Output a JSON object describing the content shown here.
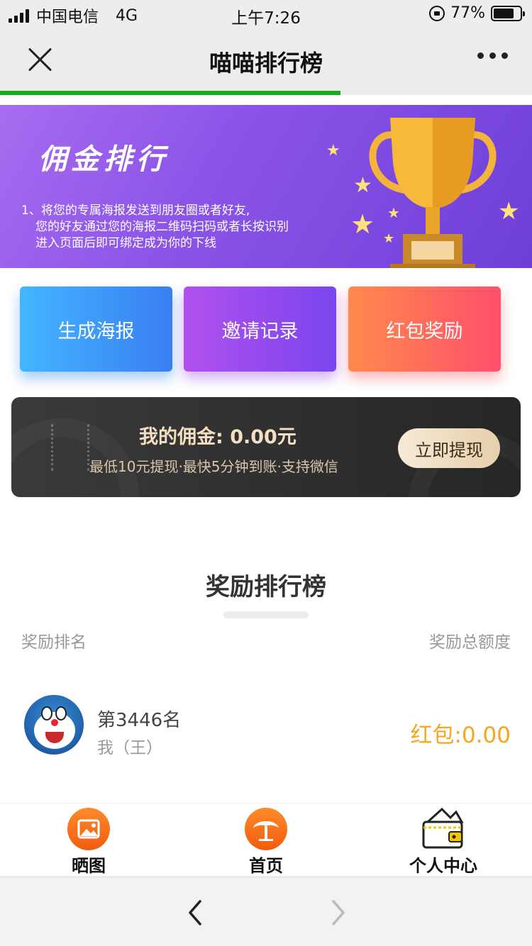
{
  "status_bar": {
    "carrier": "中国电信",
    "network": "4G",
    "time": "上午7:26",
    "battery_percent": "77%",
    "battery_level": 0.77
  },
  "nav": {
    "title": "喵喵排行榜",
    "close_icon": "close-icon",
    "more_icon": "more-icon",
    "load_progress": 0.64,
    "progress_color": "#1aad19"
  },
  "banner": {
    "title": "佣金排行",
    "desc_lines": [
      "1、将您的专属海报发送到朋友圈或者好友,",
      "您的好友通过您的海报二维码扫码或者长按识别",
      "进入页面后即可绑定成为你的下线"
    ],
    "trophy_icon": "trophy-icon"
  },
  "actions": {
    "poster": "生成海报",
    "invite": "邀请记录",
    "redpack": "红包奖励"
  },
  "commission": {
    "title": "我的佣金: 0.00元",
    "subtitle": "最低10元提现·最快5分钟到账·支持微信",
    "withdraw_button": "立即提现"
  },
  "ranking": {
    "heading": "奖励排行榜",
    "col_left": "奖励排名",
    "col_right": "奖励总额度",
    "rows": [
      {
        "rank": "第3446名",
        "user": "我（王）",
        "amount": "红包:0.00"
      }
    ]
  },
  "tab_bar": {
    "items": [
      {
        "label": "晒图",
        "icon": "image-icon"
      },
      {
        "label": "首页",
        "icon": "home-tree-icon"
      },
      {
        "label": "个人中心",
        "icon": "wallet-icon"
      }
    ]
  },
  "browser": {
    "back_icon": "chevron-left-icon",
    "forward_icon": "chevron-right-icon"
  },
  "colors": {
    "accent_orange": "#f5a623",
    "banner_purple": "#8b54e8",
    "commission_gold": "#f3e0c3"
  }
}
